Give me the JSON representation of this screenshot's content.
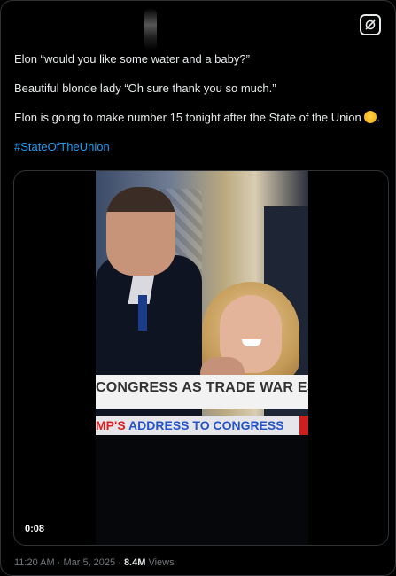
{
  "tweet": {
    "lines": [
      "Elon “would you like some water and a baby?”",
      "Beautiful blonde lady “Oh sure thank you so much.”",
      "Elon is going to make number 15 tonight after the State of the Union"
    ],
    "emoji": "rolling-on-floor-laughing",
    "line3_suffix": ".",
    "hashtag": "#StateOfTheUnion"
  },
  "video": {
    "chyron_main": "CONGRESS AS TRADE WAR ESCALA",
    "chyron_sub_prefix": "MP'S ",
    "chyron_sub_main": "ADDRESS TO CONGRESS",
    "duration": "0:08"
  },
  "meta": {
    "time": "11:20 AM",
    "separator": " · ",
    "date": "Mar 5, 2025",
    "views_count": "8.4M",
    "views_label": " Views"
  },
  "icons": {
    "grok": "grok-icon"
  },
  "colors": {
    "background": "#000000",
    "text": "#e7e9ea",
    "accent": "#1d9bf0",
    "muted": "#71767b"
  }
}
